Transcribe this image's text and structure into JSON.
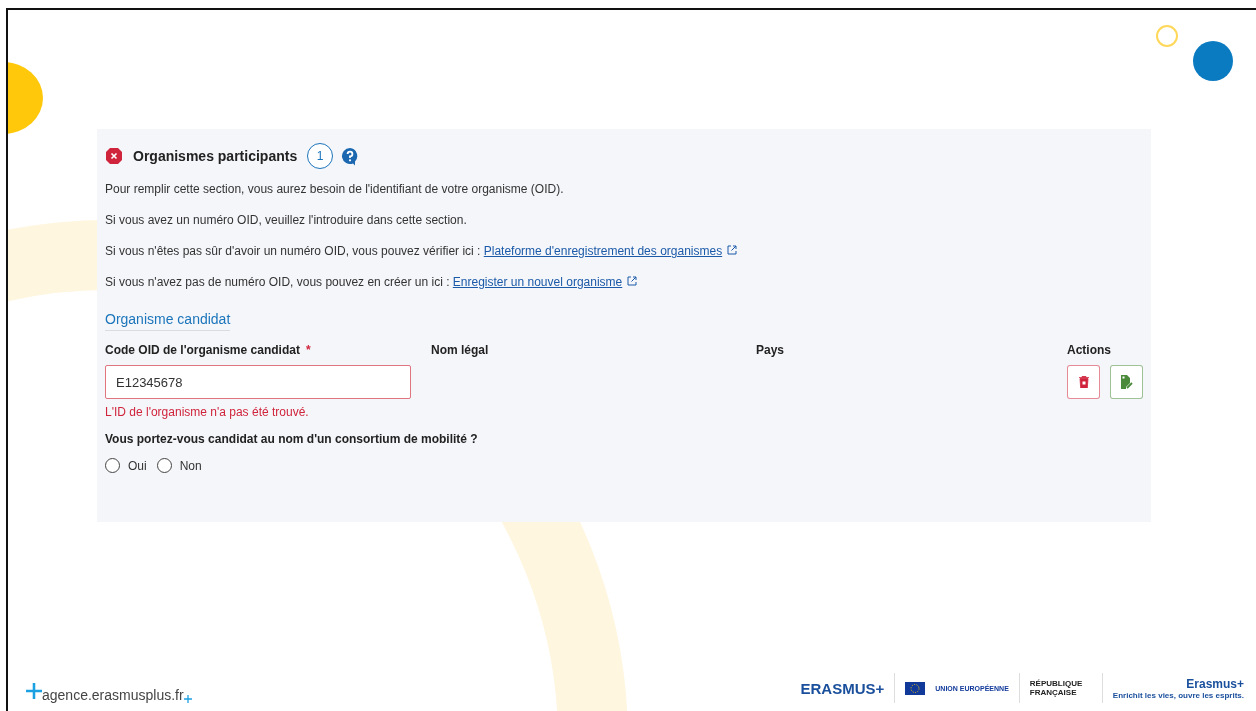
{
  "section": {
    "title": "Organismes participants",
    "has_error": true,
    "count": "1",
    "paragraphs": [
      {
        "text": "Pour remplir cette section, vous aurez besoin de l'identifiant de votre organisme (OID)."
      },
      {
        "text": "Si vous avez un numéro OID, veuillez l'introduire dans cette section."
      },
      {
        "text": "Si vous n'êtes pas sûr d'avoir un numéro OID, vous pouvez vérifier ici : ",
        "link": "Plateforme d'enregistrement des organismes"
      },
      {
        "text": "Si vous n'avez pas de numéro OID, vous pouvez en créer un ici : ",
        "link": "Enregister un nouvel organisme"
      }
    ],
    "subheading": "Organisme candidat",
    "columns": [
      {
        "label": "Code OID de l'organisme candidat",
        "required_mark": "*"
      },
      {
        "label": "Nom légal"
      },
      {
        "label": "Pays"
      },
      {
        "label": "Actions"
      }
    ],
    "oid_field": {
      "value": "E12345678",
      "invalid": true
    },
    "error": "L'ID de l'organisme n'a pas été trouvé.",
    "question": "Vous portez-vous candidat au nom d'un consortium de mobilité ?",
    "options": [
      {
        "label": "Oui",
        "selected": false
      },
      {
        "label": "Non",
        "selected": false
      }
    ]
  },
  "footer": {
    "website": "agence.erasmusplus.fr",
    "logos": [
      {
        "kind": "erasmus",
        "text": "ERASMUS+"
      },
      {
        "kind": "eu",
        "text": "UNION EUROPÉENNE"
      },
      {
        "kind": "republic",
        "text": "RÉPUBLIQUE FRANÇAISE"
      },
      {
        "kind": "brand",
        "text": "Erasmus+",
        "tagline": "Enrichit les vies, ouvre les esprits."
      }
    ]
  }
}
